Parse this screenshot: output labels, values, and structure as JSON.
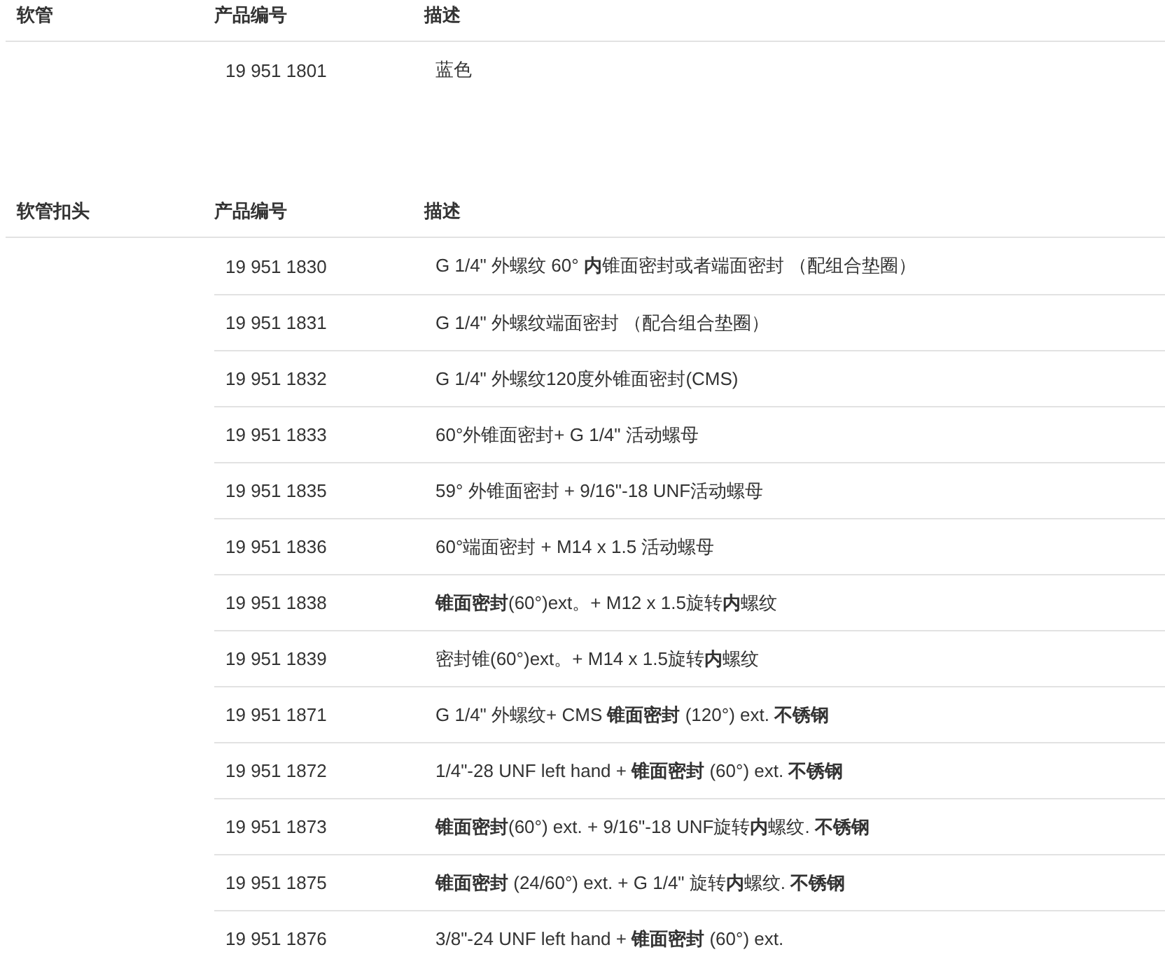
{
  "sections": [
    {
      "title": "软管",
      "columns": [
        "产品编号",
        "描述"
      ],
      "rows": [
        {
          "product_no": "19 951 1801",
          "description": "蓝色"
        }
      ]
    },
    {
      "title": "软管扣头",
      "columns": [
        "产品编号",
        "描述"
      ],
      "rows": [
        {
          "product_no": "19 951 1830",
          "description": "G 1/4\" 外螺纹 60° **内**锥面密封或者端面密封 （配组合垫圈）"
        },
        {
          "product_no": "19 951 1831",
          "description": "G 1/4\" 外螺纹端面密封 （配合组合垫圈）"
        },
        {
          "product_no": "19 951 1832",
          "description": "G 1/4\" 外螺纹120度外锥面密封(CMS)"
        },
        {
          "product_no": "19 951 1833",
          "description": "60°外锥面密封+ G 1/4\" 活动螺母"
        },
        {
          "product_no": "19 951 1835",
          "description": "59° 外锥面密封 + 9/16\"-18 UNF活动螺母"
        },
        {
          "product_no": "19 951 1836",
          "description": "60°端面密封 + M14 x 1.5 活动螺母"
        },
        {
          "product_no": "19 951 1838",
          "description": "**锥面密封**(60°)ext。+ M12 x 1.5旋转**内**螺纹"
        },
        {
          "product_no": "19 951 1839",
          "description": "密封锥(60°)ext。+ M14 x 1.5旋转**内**螺纹"
        },
        {
          "product_no": "19 951 1871",
          "description": "G 1/4\" 外螺纹+ CMS **锥面密封** (120°) ext. **不锈钢**"
        },
        {
          "product_no": "19 951 1872",
          "description": "1/4\"-28 UNF left hand + **锥面密封** (60°) ext. **不锈钢**"
        },
        {
          "product_no": "19 951 1873",
          "description": "**锥面密封**(60°) ext. + 9/16\"-18 UNF旋转**内**螺纹. **不锈钢**"
        },
        {
          "product_no": "19 951 1875",
          "description": "**锥面密封** (24/60°) ext. + G 1/4\" 旋转**内**螺纹. **不锈钢**"
        },
        {
          "product_no": "19 951 1876",
          "description": "3/8\"-24 UNF left hand + **锥面密封** (60°) ext."
        }
      ]
    }
  ]
}
